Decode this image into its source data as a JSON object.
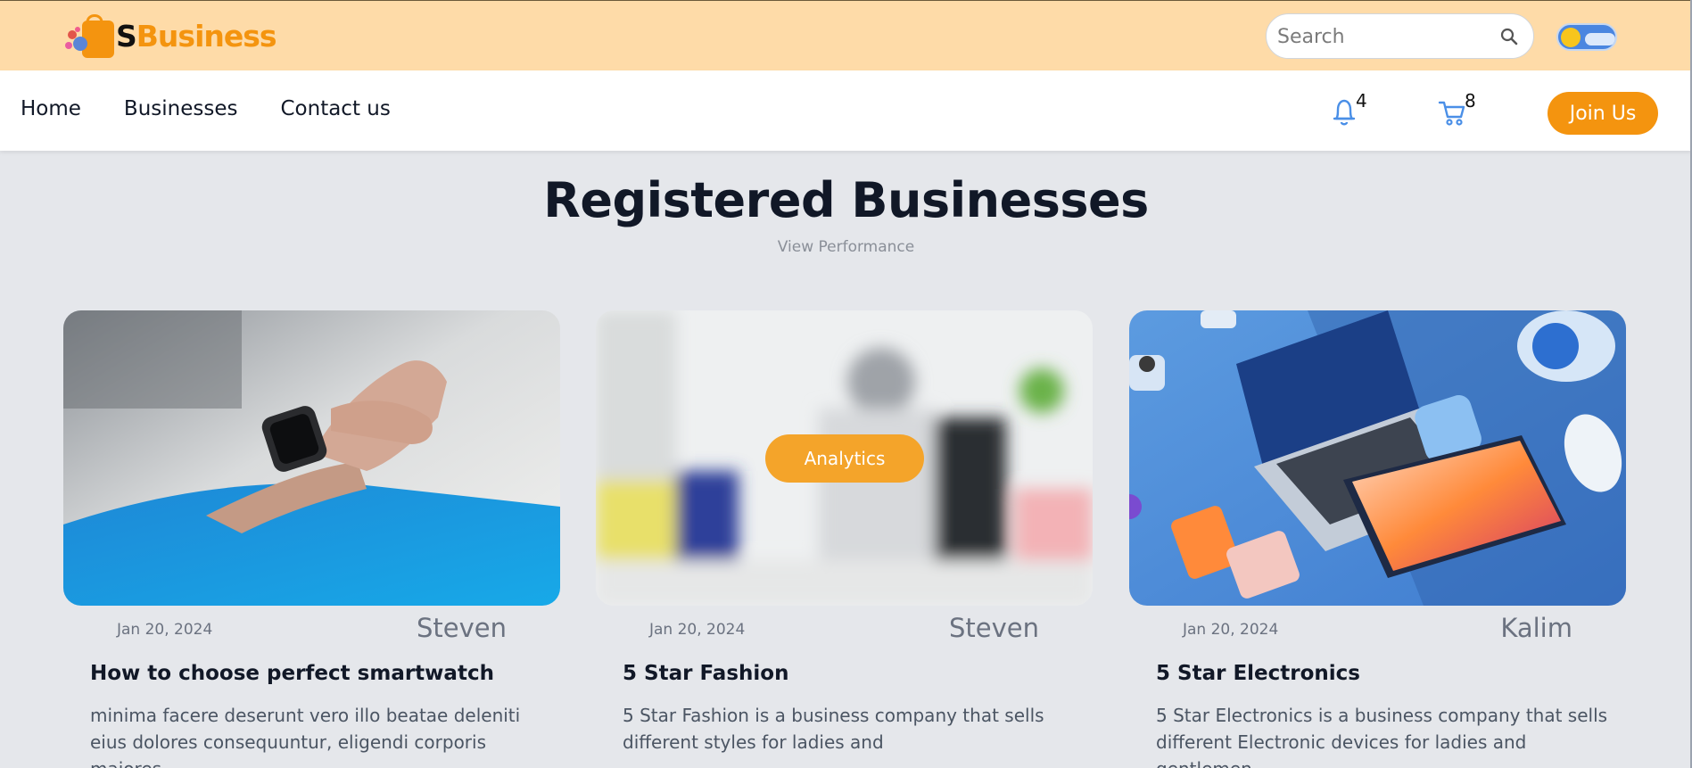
{
  "brand": {
    "logo_s": "S",
    "logo_rest": "Business"
  },
  "search": {
    "placeholder": "Search"
  },
  "nav": {
    "links": [
      "Home",
      "Businesses",
      "Contact us"
    ]
  },
  "notifications": {
    "count": "4"
  },
  "cart": {
    "count": "8"
  },
  "join_label": "Join Us",
  "heading": {
    "title": "Registered Businesses",
    "subtitle": "View Performance"
  },
  "cards": [
    {
      "date": "Jan 20, 2024",
      "author": "Steven",
      "title": "How to choose perfect smartwatch",
      "description": "minima facere deserunt vero illo beatae deleniti eius dolores consequuntur, eligendi corporis maiores..."
    },
    {
      "date": "Jan 20, 2024",
      "author": "Steven",
      "title": "5 Star Fashion",
      "description": "5 Star Fashion is a business company that sells different styles for ladies and",
      "overlay_button": "Analytics"
    },
    {
      "date": "Jan 20, 2024",
      "author": "Kalim",
      "title": "5 Star Electronics",
      "description": "5 Star Electronics is a business company that sells different Electronic devices for ladies and gentlemen"
    }
  ],
  "colors": {
    "topbar": "#fedba8",
    "accent": "#f4940f",
    "page_bg": "#e5e7eb"
  }
}
